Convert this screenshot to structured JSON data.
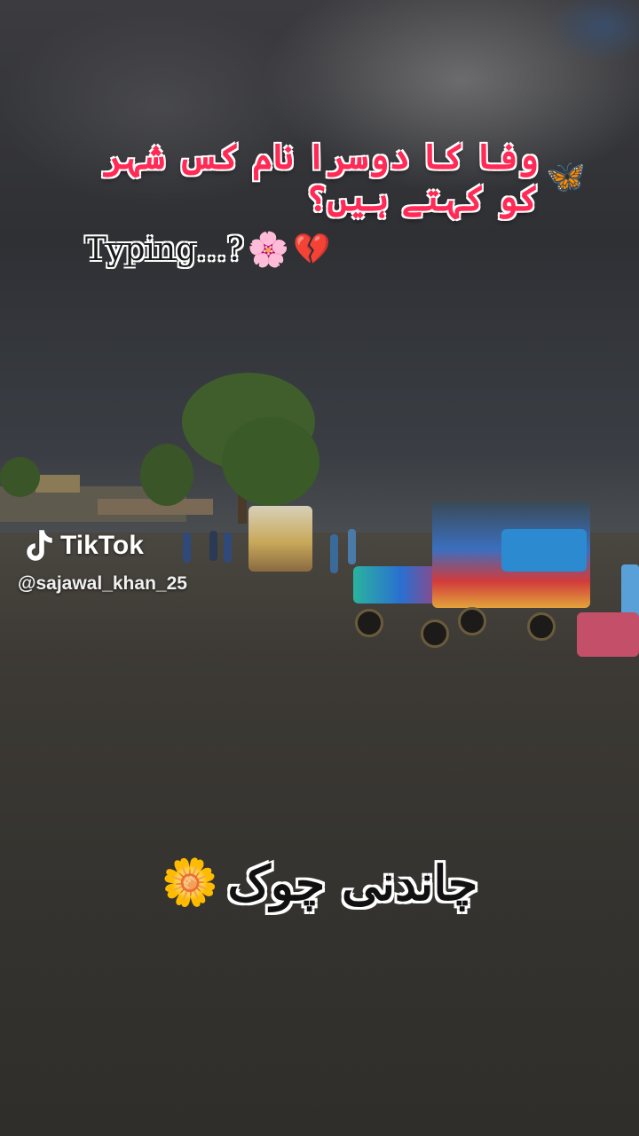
{
  "headline": {
    "text": "وفا کا دوسرا نام کس شہر کو کہتے ہیں؟",
    "emoji_icon": "butterfly-icon",
    "emoji_glyph": "🦋",
    "color": "#ff2a55"
  },
  "typing": {
    "text": "Typing...?",
    "emojis": [
      {
        "icon": "cherry-blossom-icon",
        "glyph": "🌸"
      },
      {
        "icon": "broken-heart-icon",
        "glyph": "💔"
      }
    ]
  },
  "watermark": {
    "brand": "TikTok",
    "handle": "@sajawal_khan_25",
    "icon": "tiktok-logo-icon"
  },
  "caption": {
    "text": "چاندنی چوک",
    "emoji_icon": "sunflower-icon",
    "emoji_glyph": "🌼"
  },
  "colors": {
    "headline": "#ff2a55",
    "outline": "#ffffff",
    "caption": "#111111"
  }
}
